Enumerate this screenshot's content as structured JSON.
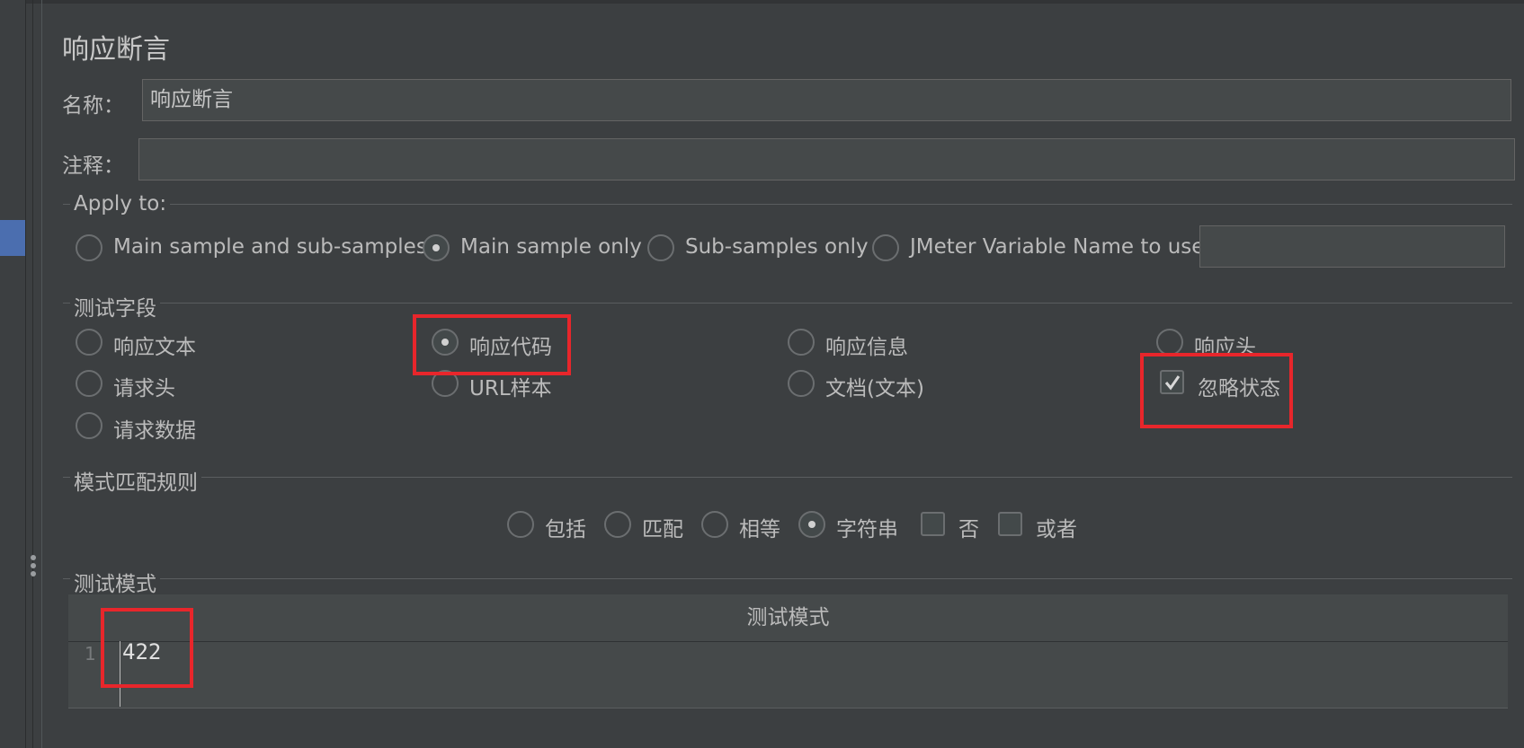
{
  "panel": {
    "title": "响应断言"
  },
  "name_field": {
    "label": "名称：",
    "value": "响应断言"
  },
  "comment_field": {
    "label": "注释：",
    "value": ""
  },
  "apply_to": {
    "title": "Apply to:",
    "options": [
      {
        "label": "Main sample and sub-samples",
        "selected": false
      },
      {
        "label": "Main sample only",
        "selected": true
      },
      {
        "label": "Sub-samples only",
        "selected": false
      },
      {
        "label": "JMeter Variable Name to use",
        "selected": false
      }
    ],
    "variable_value": ""
  },
  "test_field": {
    "title": "测试字段",
    "options": [
      {
        "label": "响应文本",
        "selected": false
      },
      {
        "label": "响应代码",
        "selected": true
      },
      {
        "label": "响应信息",
        "selected": false
      },
      {
        "label": "响应头",
        "selected": false
      },
      {
        "label": "请求头",
        "selected": false
      },
      {
        "label": "URL样本",
        "selected": false
      },
      {
        "label": "文档(文本)",
        "selected": false
      },
      {
        "label": "请求数据",
        "selected": false
      }
    ],
    "ignore_status": {
      "label": "忽略状态",
      "checked": true
    }
  },
  "pattern_rules": {
    "title": "模式匹配规则",
    "options": [
      {
        "label": "包括",
        "selected": false
      },
      {
        "label": "匹配",
        "selected": false
      },
      {
        "label": "相等",
        "selected": false
      },
      {
        "label": "字符串",
        "selected": true
      }
    ],
    "checkboxes": [
      {
        "label": "否",
        "checked": false
      },
      {
        "label": "或者",
        "checked": false
      }
    ]
  },
  "test_patterns": {
    "title": "测试模式",
    "column_header": "测试模式",
    "rows": [
      {
        "num": "1",
        "value": "422"
      }
    ]
  },
  "colors": {
    "background": "#3c3f41",
    "highlight": "#e8262b",
    "selection": "#4b6eaf"
  }
}
